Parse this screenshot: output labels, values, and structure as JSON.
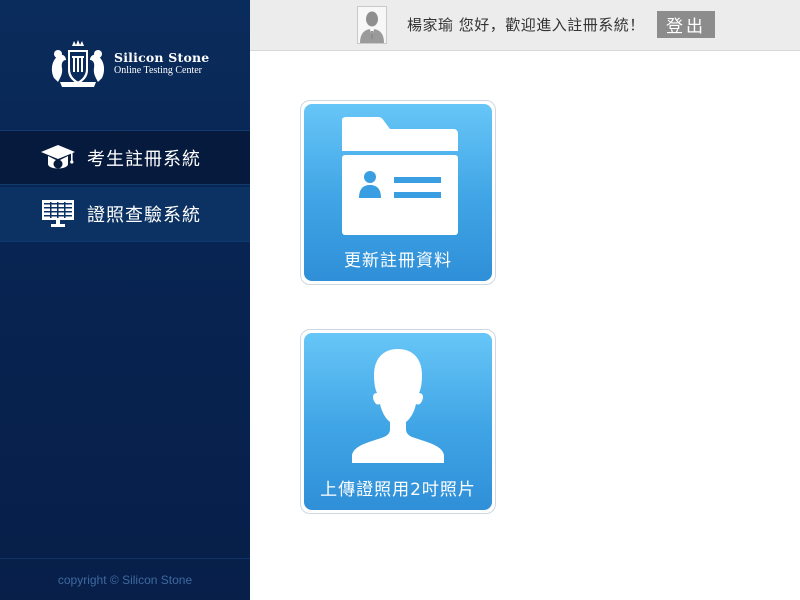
{
  "brand": {
    "title": "Silicon Stone",
    "subtitle": "Online Testing Center"
  },
  "nav": {
    "items": [
      {
        "label": "考生註冊系統",
        "icon": "graduation-cap-icon"
      },
      {
        "label": "證照查驗系統",
        "icon": "monitor-table-icon"
      }
    ]
  },
  "footer": {
    "copyright": "copyright © Silicon Stone"
  },
  "header": {
    "welcome": "楊家瑜 您好，歡迎進入註冊系統！",
    "logout_label": "登出",
    "avatar_icon": "user-avatar-icon"
  },
  "tiles": [
    {
      "label": "更新註冊資料",
      "icon": "folder-id-card-icon"
    },
    {
      "label": "上傳證照用2吋照片",
      "icon": "person-silhouette-icon"
    }
  ],
  "colors": {
    "sidebar": "#082452",
    "tile_top": "#67c6f7",
    "tile_bottom": "#2f8fd8",
    "logout_bg": "#8c8c8c"
  }
}
